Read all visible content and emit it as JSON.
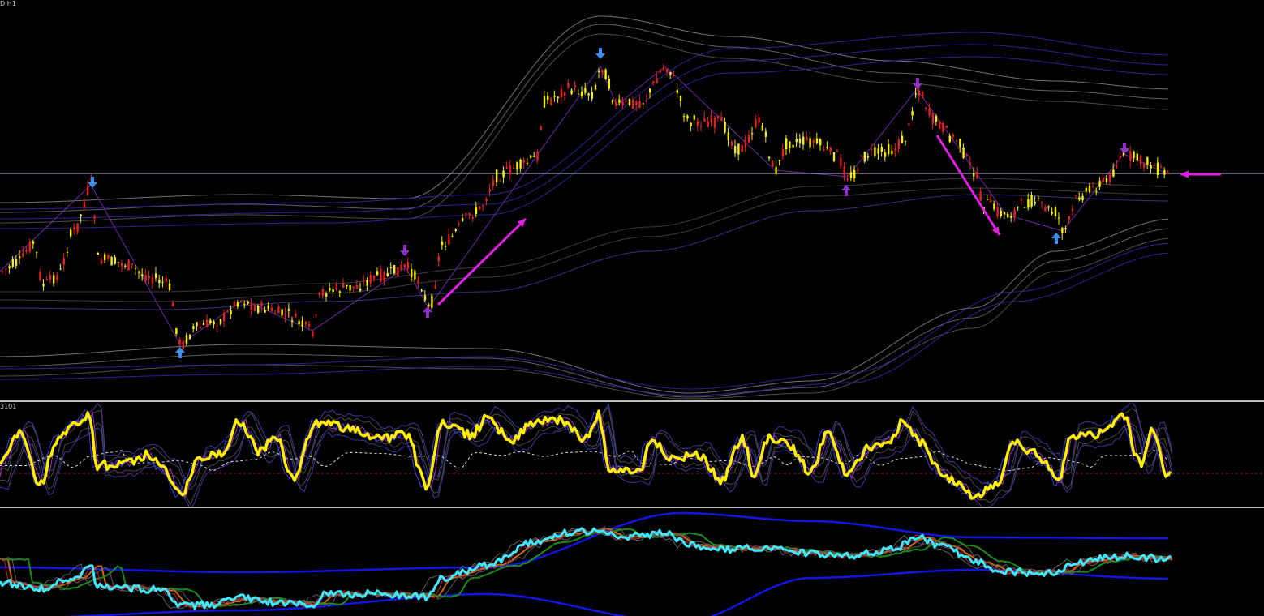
{
  "window": {
    "symbol_period_label": "D,H1"
  },
  "indicator1": {
    "label": "3101"
  },
  "colors": {
    "background": "#000000",
    "bull_candle": "#f5f000",
    "bear_candle": "#e62020",
    "price_line": "#aab8d0",
    "signal_arrow_blue": "#3a8eef",
    "signal_arrow_purple": "#9030c8",
    "trend_arrow_magenta": "#e020e0",
    "oscillator_main": "#ffee00",
    "oscillator_fast": "#3f3fe0",
    "oscillator_level": "#8a1a3a",
    "lower_price_line": "#3ee8ff",
    "lower_envelope": "#1414e0"
  },
  "markers": {
    "up_arrow_icon": "arrow-up-icon",
    "down_arrow_icon": "arrow-down-icon",
    "trend_arrow_icon": "trend-arrow-icon"
  }
}
